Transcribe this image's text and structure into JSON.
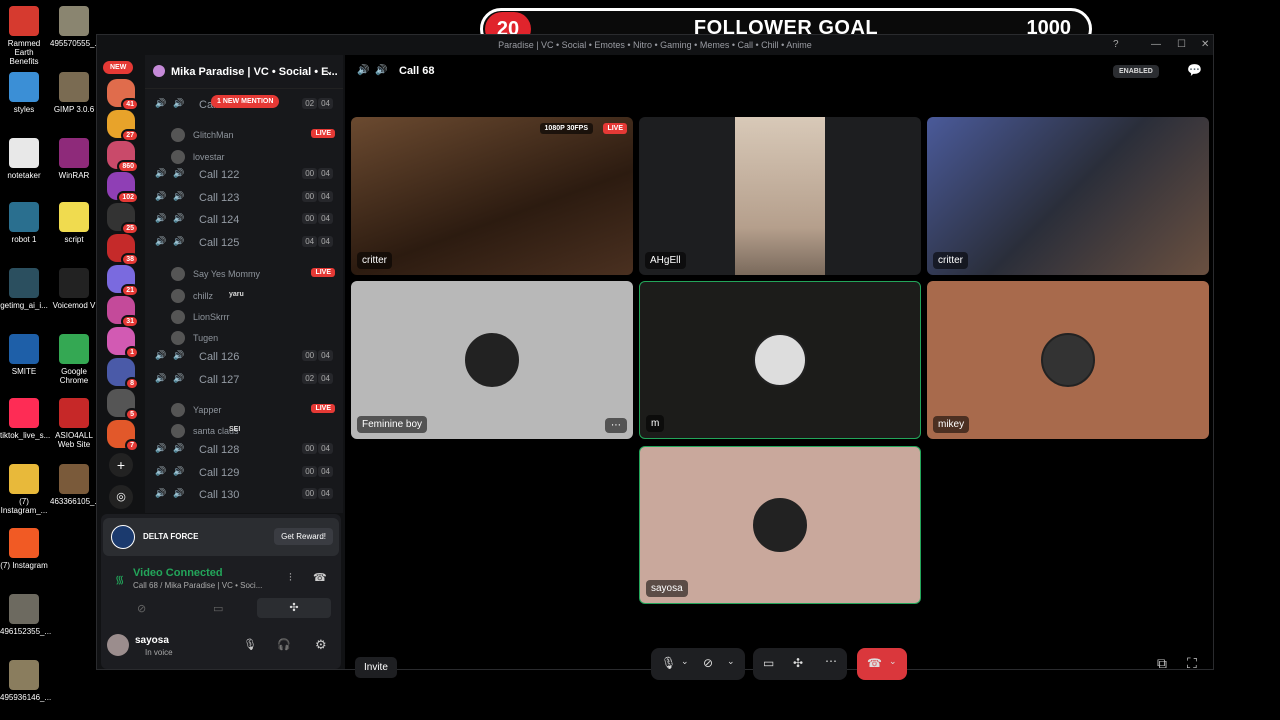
{
  "desktop_icons": [
    {
      "label": "Rammed Earth Benefits",
      "icon": "pdf-icon",
      "color": "#d63a2f"
    },
    {
      "label": "495570555_...",
      "icon": "image-thumb-icon",
      "color": "#8a8570"
    },
    {
      "label": "styles",
      "icon": "hash-file-icon",
      "color": "#3b8fd6"
    },
    {
      "label": "GIMP 3.0.6",
      "icon": "gimp-icon",
      "color": "#7a6b52"
    },
    {
      "label": "notetaker",
      "icon": "json-file-icon",
      "color": "#e8e8e8"
    },
    {
      "label": "WinRAR",
      "icon": "winrar-icon",
      "color": "#8e2a7a"
    },
    {
      "label": "robot 1",
      "icon": "robot-icon",
      "color": "#2a6f8f"
    },
    {
      "label": "script",
      "icon": "js-file-icon",
      "color": "#f0db4f"
    },
    {
      "label": "getimg_ai_i...",
      "icon": "image-thumb-icon",
      "color": "#2b4f5f"
    },
    {
      "label": "Voicemod V",
      "icon": "voicemod-icon",
      "color": "#222222"
    },
    {
      "label": "SMITE",
      "icon": "smite-icon",
      "color": "#1e5fa8"
    },
    {
      "label": "Google Chrome",
      "icon": "chrome-icon",
      "color": "#34a853"
    },
    {
      "label": "tiktok_live_s...",
      "icon": "tiktok-icon",
      "color": "#fe2c55"
    },
    {
      "label": "ASIO4ALL Web Site",
      "icon": "asio-icon",
      "color": "#c62828"
    },
    {
      "label": "(7) Instagram_...",
      "icon": "folder-icon",
      "color": "#e8b93a"
    },
    {
      "label": "463366105_...",
      "icon": "image-thumb-icon",
      "color": "#7a5a3a"
    },
    {
      "label": "(7) Instagram",
      "icon": "brave-icon",
      "color": "#f15a24"
    },
    {
      "label": "496152355_...",
      "icon": "image-thumb-icon",
      "color": "#6d6a60"
    },
    {
      "label": "495936146_...",
      "icon": "image-thumb-icon",
      "color": "#8a7d5e"
    }
  ],
  "follower_goal": {
    "current": "20",
    "title": "FOLLOWER GOAL",
    "target": "1000"
  },
  "window": {
    "title": "Paradise | VC • Social • Emotes • Nitro • Gaming • Memes • Call • Chill • Anime"
  },
  "server": {
    "name": "Mika Paradise | VC • Social • E...",
    "new_label": "NEW",
    "mention_label": "1 NEW MENTION"
  },
  "server_badges": [
    "41",
    "27",
    "860",
    "102",
    "25",
    "38",
    "21",
    "31",
    "1",
    "8",
    "5",
    "7"
  ],
  "channels": [
    {
      "name": "Call 121",
      "a": "02",
      "b": "04",
      "active": true
    },
    {
      "name": "Call 122",
      "a": "00",
      "b": "04",
      "active": false
    },
    {
      "name": "Call 123",
      "a": "00",
      "b": "04",
      "active": false
    },
    {
      "name": "Call 124",
      "a": "00",
      "b": "04",
      "active": false
    },
    {
      "name": "Call 125",
      "a": "04",
      "b": "04",
      "active": true
    },
    {
      "name": "Call 126",
      "a": "00",
      "b": "04",
      "active": false
    },
    {
      "name": "Call 127",
      "a": "02",
      "b": "04",
      "active": true
    },
    {
      "name": "Call 128",
      "a": "00",
      "b": "04",
      "active": false
    },
    {
      "name": "Call 129",
      "a": "00",
      "b": "04",
      "active": false
    },
    {
      "name": "Call 130",
      "a": "00",
      "b": "04",
      "active": false
    }
  ],
  "users": {
    "glitchman": "GlitchMan",
    "lovestar": "lovestar",
    "sayyes": "Say Yes Mommy",
    "chillz": "chillz",
    "chillz_tag": "yaru",
    "lionskrrr": "LionSkrrr",
    "tugen": "Tugen",
    "yapper": "Yapper",
    "santa": "santa claus",
    "santa_tag": "SEI",
    "live": "LIVE"
  },
  "promo": {
    "name": "DELTA FORCE",
    "button": "Get Reward!"
  },
  "voice": {
    "status": "Video Connected",
    "location": "Call 68 / Mika Paradise | VC • Soci..."
  },
  "me": {
    "name": "sayosa",
    "status": "In voice"
  },
  "call": {
    "title": "Call 68",
    "enabled": "ENABLED",
    "stream_quality": "1080P 30FPS",
    "live": "LIVE",
    "invite": "Invite"
  },
  "tiles": {
    "t1": "critter",
    "t2": "AHgEll",
    "t3": "critter",
    "t4": "Feminine boy",
    "t5": "m",
    "t6": "mikey",
    "t7": "sayosa"
  },
  "colors": {
    "accent": "#5865f2",
    "green": "#23a55a",
    "red": "#da373c"
  }
}
